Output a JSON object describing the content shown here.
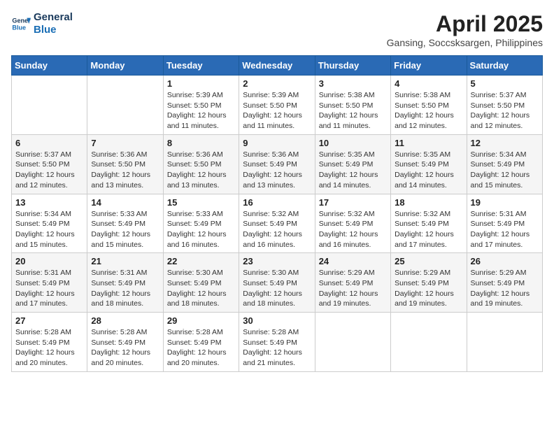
{
  "header": {
    "logo_line1": "General",
    "logo_line2": "Blue",
    "title": "April 2025",
    "subtitle": "Gansing, Soccsksargen, Philippines"
  },
  "columns": [
    "Sunday",
    "Monday",
    "Tuesday",
    "Wednesday",
    "Thursday",
    "Friday",
    "Saturday"
  ],
  "weeks": [
    [
      {
        "day": "",
        "info": ""
      },
      {
        "day": "",
        "info": ""
      },
      {
        "day": "1",
        "info": "Sunrise: 5:39 AM\nSunset: 5:50 PM\nDaylight: 12 hours and 11 minutes."
      },
      {
        "day": "2",
        "info": "Sunrise: 5:39 AM\nSunset: 5:50 PM\nDaylight: 12 hours and 11 minutes."
      },
      {
        "day": "3",
        "info": "Sunrise: 5:38 AM\nSunset: 5:50 PM\nDaylight: 12 hours and 11 minutes."
      },
      {
        "day": "4",
        "info": "Sunrise: 5:38 AM\nSunset: 5:50 PM\nDaylight: 12 hours and 12 minutes."
      },
      {
        "day": "5",
        "info": "Sunrise: 5:37 AM\nSunset: 5:50 PM\nDaylight: 12 hours and 12 minutes."
      }
    ],
    [
      {
        "day": "6",
        "info": "Sunrise: 5:37 AM\nSunset: 5:50 PM\nDaylight: 12 hours and 12 minutes."
      },
      {
        "day": "7",
        "info": "Sunrise: 5:36 AM\nSunset: 5:50 PM\nDaylight: 12 hours and 13 minutes."
      },
      {
        "day": "8",
        "info": "Sunrise: 5:36 AM\nSunset: 5:50 PM\nDaylight: 12 hours and 13 minutes."
      },
      {
        "day": "9",
        "info": "Sunrise: 5:36 AM\nSunset: 5:49 PM\nDaylight: 12 hours and 13 minutes."
      },
      {
        "day": "10",
        "info": "Sunrise: 5:35 AM\nSunset: 5:49 PM\nDaylight: 12 hours and 14 minutes."
      },
      {
        "day": "11",
        "info": "Sunrise: 5:35 AM\nSunset: 5:49 PM\nDaylight: 12 hours and 14 minutes."
      },
      {
        "day": "12",
        "info": "Sunrise: 5:34 AM\nSunset: 5:49 PM\nDaylight: 12 hours and 15 minutes."
      }
    ],
    [
      {
        "day": "13",
        "info": "Sunrise: 5:34 AM\nSunset: 5:49 PM\nDaylight: 12 hours and 15 minutes."
      },
      {
        "day": "14",
        "info": "Sunrise: 5:33 AM\nSunset: 5:49 PM\nDaylight: 12 hours and 15 minutes."
      },
      {
        "day": "15",
        "info": "Sunrise: 5:33 AM\nSunset: 5:49 PM\nDaylight: 12 hours and 16 minutes."
      },
      {
        "day": "16",
        "info": "Sunrise: 5:32 AM\nSunset: 5:49 PM\nDaylight: 12 hours and 16 minutes."
      },
      {
        "day": "17",
        "info": "Sunrise: 5:32 AM\nSunset: 5:49 PM\nDaylight: 12 hours and 16 minutes."
      },
      {
        "day": "18",
        "info": "Sunrise: 5:32 AM\nSunset: 5:49 PM\nDaylight: 12 hours and 17 minutes."
      },
      {
        "day": "19",
        "info": "Sunrise: 5:31 AM\nSunset: 5:49 PM\nDaylight: 12 hours and 17 minutes."
      }
    ],
    [
      {
        "day": "20",
        "info": "Sunrise: 5:31 AM\nSunset: 5:49 PM\nDaylight: 12 hours and 17 minutes."
      },
      {
        "day": "21",
        "info": "Sunrise: 5:31 AM\nSunset: 5:49 PM\nDaylight: 12 hours and 18 minutes."
      },
      {
        "day": "22",
        "info": "Sunrise: 5:30 AM\nSunset: 5:49 PM\nDaylight: 12 hours and 18 minutes."
      },
      {
        "day": "23",
        "info": "Sunrise: 5:30 AM\nSunset: 5:49 PM\nDaylight: 12 hours and 18 minutes."
      },
      {
        "day": "24",
        "info": "Sunrise: 5:29 AM\nSunset: 5:49 PM\nDaylight: 12 hours and 19 minutes."
      },
      {
        "day": "25",
        "info": "Sunrise: 5:29 AM\nSunset: 5:49 PM\nDaylight: 12 hours and 19 minutes."
      },
      {
        "day": "26",
        "info": "Sunrise: 5:29 AM\nSunset: 5:49 PM\nDaylight: 12 hours and 19 minutes."
      }
    ],
    [
      {
        "day": "27",
        "info": "Sunrise: 5:28 AM\nSunset: 5:49 PM\nDaylight: 12 hours and 20 minutes."
      },
      {
        "day": "28",
        "info": "Sunrise: 5:28 AM\nSunset: 5:49 PM\nDaylight: 12 hours and 20 minutes."
      },
      {
        "day": "29",
        "info": "Sunrise: 5:28 AM\nSunset: 5:49 PM\nDaylight: 12 hours and 20 minutes."
      },
      {
        "day": "30",
        "info": "Sunrise: 5:28 AM\nSunset: 5:49 PM\nDaylight: 12 hours and 21 minutes."
      },
      {
        "day": "",
        "info": ""
      },
      {
        "day": "",
        "info": ""
      },
      {
        "day": "",
        "info": ""
      }
    ]
  ]
}
